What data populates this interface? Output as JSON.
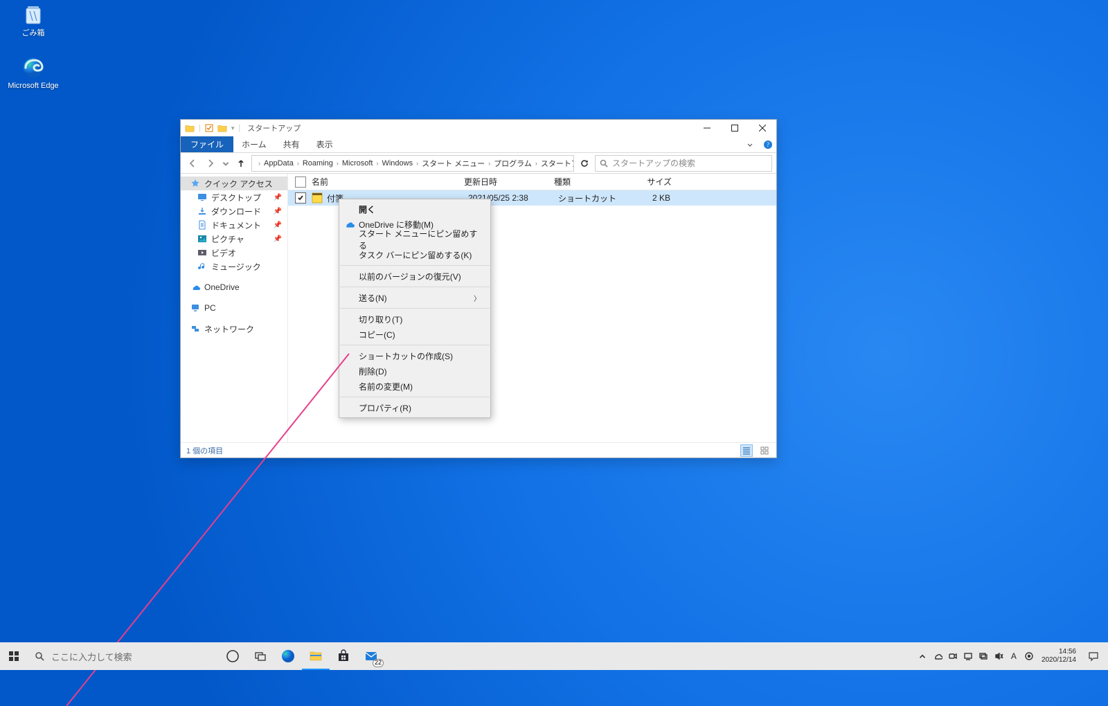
{
  "desktop": {
    "icons": [
      {
        "name": "ごみ箱"
      },
      {
        "name": "Microsoft Edge"
      }
    ]
  },
  "explorer": {
    "title": "スタートアップ",
    "tabs": {
      "file": "ファイル",
      "home": "ホーム",
      "share": "共有",
      "view": "表示"
    },
    "breadcrumb": [
      "AppData",
      "Roaming",
      "Microsoft",
      "Windows",
      "スタート メニュー",
      "プログラム",
      "スタートアップ"
    ],
    "search_placeholder": "スタートアップの検索",
    "nav": {
      "quick_access": "クイック アクセス",
      "desktop": "デスクトップ",
      "downloads": "ダウンロード",
      "documents": "ドキュメント",
      "pictures": "ピクチャ",
      "videos": "ビデオ",
      "music": "ミュージック",
      "onedrive": "OneDrive",
      "pc": "PC",
      "network": "ネットワーク"
    },
    "columns": {
      "name": "名前",
      "date": "更新日時",
      "type": "種類",
      "size": "サイズ"
    },
    "rows": [
      {
        "name": "付箋",
        "date": "2021/05/25 2:38",
        "type": "ショートカット",
        "size": "2 KB"
      }
    ],
    "status": "1 個の項目"
  },
  "context_menu": {
    "open": "開く",
    "onedrive_move": "OneDrive に移動(M)",
    "pin_start": "スタート メニューにピン留めする",
    "pin_taskbar": "タスク バーにピン留めする(K)",
    "restore_previous": "以前のバージョンの復元(V)",
    "send_to": "送る(N)",
    "cut": "切り取り(T)",
    "copy": "コピー(C)",
    "create_shortcut": "ショートカットの作成(S)",
    "delete": "削除(D)",
    "rename": "名前の変更(M)",
    "properties": "プロパティ(R)"
  },
  "taskbar": {
    "search_placeholder": "ここに入力して検索",
    "mail_badge": "22",
    "time": "14:56",
    "date": "2020/12/14"
  }
}
